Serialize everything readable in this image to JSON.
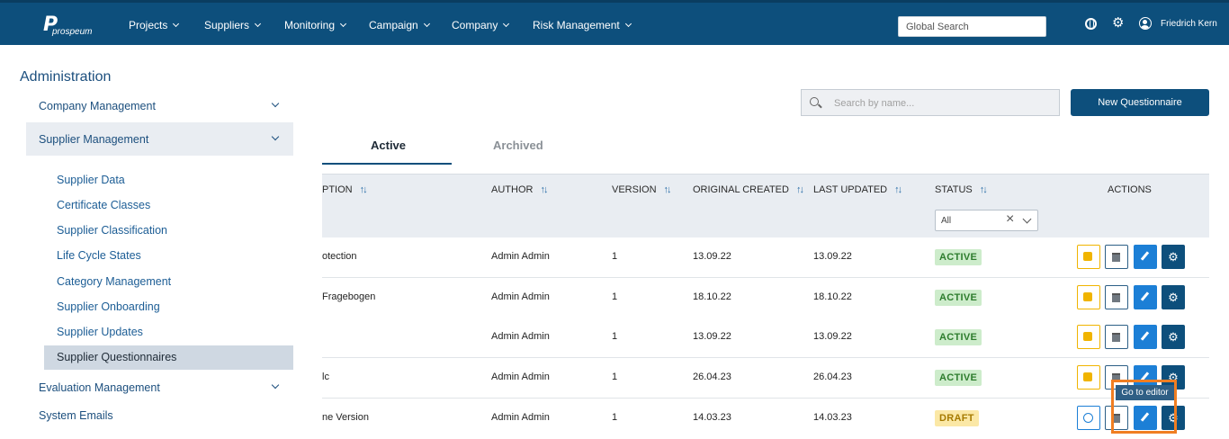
{
  "header": {
    "logo_text": "prospeum",
    "logo_mark": "P",
    "nav": [
      {
        "label": "Projects"
      },
      {
        "label": "Suppliers"
      },
      {
        "label": "Monitoring"
      },
      {
        "label": "Campaign"
      },
      {
        "label": "Company"
      },
      {
        "label": "Risk Management"
      }
    ],
    "global_search_placeholder": "Global Search",
    "username": "Friedrich Kern",
    "icons": [
      "globe-icon",
      "gear-icon",
      "user-icon"
    ]
  },
  "sidebar": {
    "title": "Administration",
    "groups": [
      {
        "label": "Company Management"
      },
      {
        "label": "Supplier Management"
      },
      {
        "label": "Evaluation Management"
      },
      {
        "label": "System Emails"
      }
    ],
    "sub_items": [
      {
        "label": "Supplier Data"
      },
      {
        "label": "Certificate Classes"
      },
      {
        "label": "Supplier Classification"
      },
      {
        "label": "Life Cycle States"
      },
      {
        "label": "Category Management"
      },
      {
        "label": "Supplier Onboarding"
      },
      {
        "label": "Supplier Updates"
      },
      {
        "label": "Supplier Questionnaires"
      }
    ],
    "active_sub_item": "Supplier Questionnaires"
  },
  "toolbar": {
    "search_placeholder": "Search by name...",
    "new_button": "New Questionnaire"
  },
  "tabs": [
    {
      "label": "Active",
      "selected": true
    },
    {
      "label": "Archived",
      "selected": false
    }
  ],
  "table": {
    "headers": {
      "description": "PTION",
      "author": "AUTHOR",
      "version": "VERSION",
      "created": "ORIGINAL CREATED",
      "updated": "LAST UPDATED",
      "status": "STATUS",
      "actions": "ACTIONS"
    },
    "status_filter": "All",
    "rows": [
      {
        "description": "otection",
        "author": "Admin Admin",
        "version": "1",
        "created": "13.09.22",
        "updated": "13.09.22",
        "status": "ACTIVE"
      },
      {
        "description": "Fragebogen",
        "author": "Admin Admin",
        "version": "1",
        "created": "18.10.22",
        "updated": "18.10.22",
        "status": "ACTIVE"
      },
      {
        "description": "",
        "author": "Admin Admin",
        "version": "1",
        "created": "13.09.22",
        "updated": "13.09.22",
        "status": "ACTIVE"
      },
      {
        "description": "lc",
        "author": "Admin Admin",
        "version": "1",
        "created": "26.04.23",
        "updated": "26.04.23",
        "status": "ACTIVE"
      },
      {
        "description": "ne Version",
        "author": "Admin Admin",
        "version": "1",
        "created": "14.03.23",
        "updated": "14.03.23",
        "status": "DRAFT"
      }
    ]
  },
  "tooltip": "Go to editor",
  "colors": {
    "brand": "#0d4f7c",
    "active_badge_bg": "#cdeccb",
    "draft_badge_bg": "#fbe8a6",
    "highlight": "#f07e22"
  }
}
